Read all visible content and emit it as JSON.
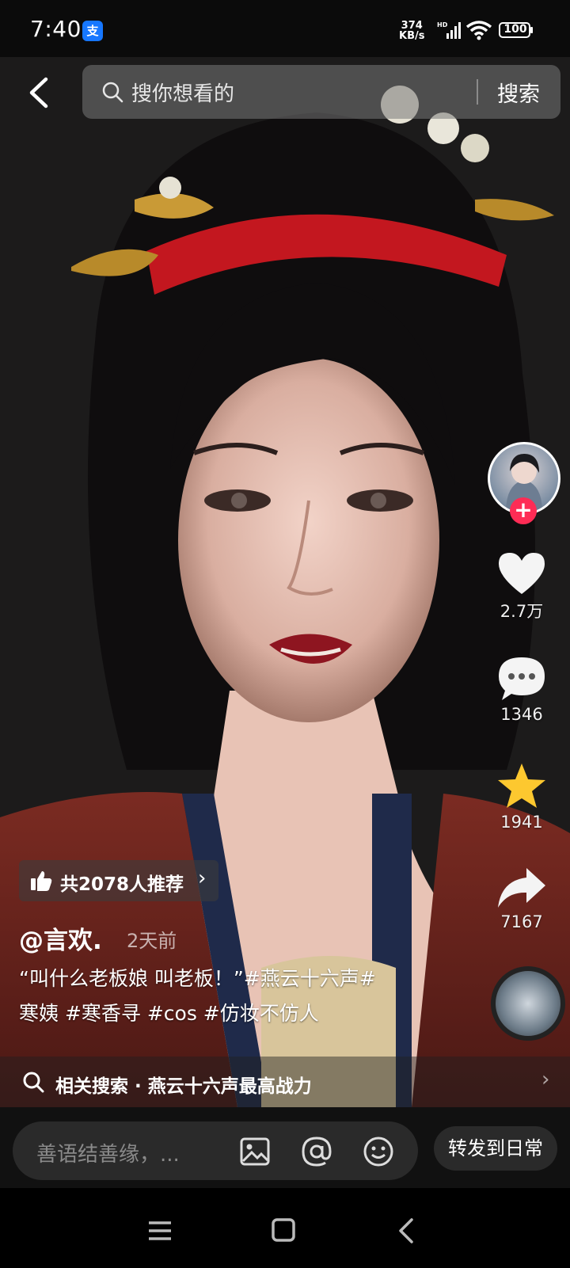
{
  "status_bar": {
    "time": "7:40",
    "app_badge": "支",
    "net_speed_value": "374",
    "net_speed_unit": "KB/s",
    "hd_label": "HD",
    "battery": "100"
  },
  "search": {
    "placeholder": "搜你想看的",
    "button_label": "搜索"
  },
  "actions": {
    "likes": "2.7万",
    "comments": "1346",
    "favorites": "1941",
    "shares": "7167"
  },
  "recommend": {
    "label": "共2078人推荐",
    "arrow": "›"
  },
  "post": {
    "author": "@言欢.",
    "time_ago": "2天前",
    "caption_line1": "“叫什么老板娘 叫老板！”#燕云十六声#",
    "caption_line2": "寒姨 #寒香寻  #cos #仿妆不仿人"
  },
  "related_search": {
    "label": "相关搜索 · 燕云十六声最高战力",
    "arrow": "›"
  },
  "comment_bar": {
    "placeholder": "善语结善缘，...",
    "share_label": "转发到日常"
  },
  "colors": {
    "accent_red": "#fe2c55",
    "favorite_yellow": "#fdc82f"
  }
}
